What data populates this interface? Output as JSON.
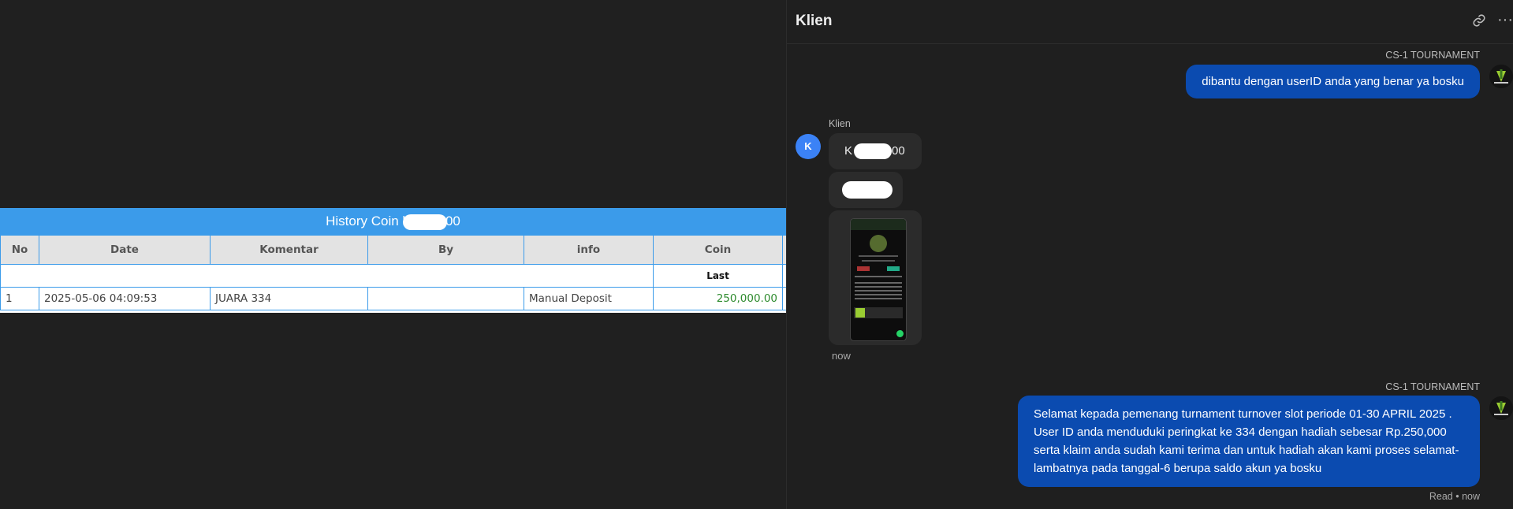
{
  "history": {
    "title": "History Coin k",
    "title_suffix": "00",
    "columns": [
      "No",
      "Date",
      "Komentar",
      "By",
      "info",
      "Coin"
    ],
    "last_label": "Last",
    "rows": [
      {
        "no": "1",
        "date": "2025-05-06 04:09:53",
        "komentar": "JUARA 334",
        "by": "",
        "info": "Manual Deposit",
        "coin": "250,000.00"
      }
    ]
  },
  "chat": {
    "title": "Klien",
    "messages": [
      {
        "sender": "CS-1 TOURNAMENT",
        "text": "dibantu dengan userID anda yang benar ya bosku"
      },
      {
        "sender": "Klien",
        "avatar": "K",
        "bubble1_prefix": "K",
        "bubble1_suffix": "00",
        "time": "now"
      },
      {
        "sender": "CS-1 TOURNAMENT",
        "text": "Selamat kepada pemenang turnament turnover slot periode 01-30 APRIL 2025 . User ID anda menduduki peringkat ke 334 dengan hadiah sebesar Rp.250,000 serta klaim anda sudah kami terima dan untuk hadiah akan kami proses selamat-lambatnya pada tanggal-6 berupa saldo akun ya bosku",
        "status": "Read • now"
      }
    ]
  },
  "icons": {
    "link": "link-icon",
    "more": "more-icon",
    "logo": "tournament-logo-icon"
  },
  "colors": {
    "table_header": "#3b9bea",
    "bubble_out": "#0b4bb0",
    "coin_text": "#2e8b2e",
    "avatar_k": "#3b82f6"
  }
}
